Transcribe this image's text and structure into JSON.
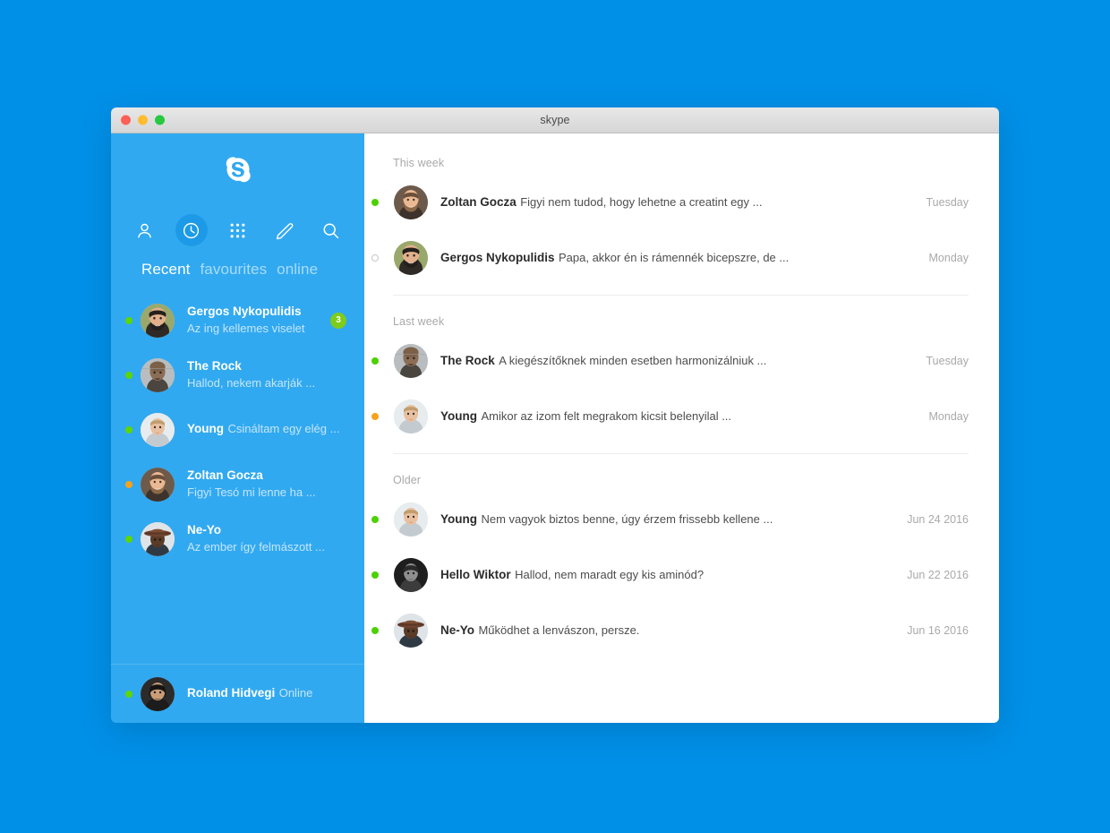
{
  "colors": {
    "page_background": "#0090e8",
    "sidebar_background": "#31a9f0",
    "active_icon_background": "#1d9ae7",
    "badge_green": "#7ecc1b",
    "presence_online": "#5ed600",
    "presence_away": "#f7a21b",
    "main_background": "#ffffff"
  },
  "window": {
    "title": "skype",
    "controls": {
      "close_label": "close",
      "minimize_label": "minimize",
      "maximize_label": "maximize"
    }
  },
  "sidebar": {
    "logo_letter": "S",
    "icons": [
      {
        "name": "contacts-icon",
        "active": false
      },
      {
        "name": "recent-clock-icon",
        "active": true
      },
      {
        "name": "dialpad-icon",
        "active": false
      },
      {
        "name": "compose-pencil-icon",
        "active": false
      },
      {
        "name": "search-icon",
        "active": false
      }
    ],
    "tabs": [
      {
        "label": "Recent",
        "active": true
      },
      {
        "label": "favourites",
        "active": false
      },
      {
        "label": "online",
        "active": false
      }
    ],
    "chats": [
      {
        "name": "Gergos Nykopulidis",
        "snippet": "Az ing kellemes viselet",
        "presence": "online",
        "badge": "3",
        "avatar": "man-beard-green"
      },
      {
        "name": "The Rock",
        "snippet": "Hallod, nekem akarják ...",
        "presence": "online",
        "badge": "",
        "avatar": "man-bald-gray"
      },
      {
        "name": "Young",
        "snippet": "Csináltam egy elég ...",
        "presence": "online",
        "badge": "",
        "avatar": "man-young-light"
      },
      {
        "name": "Zoltan Gocza",
        "snippet": "Figyi Tesó mi lenne ha ...",
        "presence": "away",
        "badge": "",
        "avatar": "man-beard-brown"
      },
      {
        "name": "Ne-Yo",
        "snippet": "Az ember így felmászott ...",
        "presence": "online",
        "badge": "",
        "avatar": "man-hat-dark"
      }
    ],
    "me": {
      "name": "Roland Hidvegi",
      "status": "Online",
      "presence": "online",
      "avatar": "man-dark-hair"
    }
  },
  "main": {
    "sections": [
      {
        "heading": "This week",
        "rows": [
          {
            "name": "Zoltan Gocza",
            "snippet": "Figyi nem tudod, hogy lehetne a creatint egy ...",
            "time": "Tuesday",
            "presence": "online",
            "avatar": "man-beard-brown"
          },
          {
            "name": "Gergos Nykopulidis",
            "snippet": "Papa, akkor én is rámennék bicepszre, de ...",
            "time": "Monday",
            "presence": "offline",
            "avatar": "man-beard-green"
          }
        ]
      },
      {
        "heading": "Last week",
        "rows": [
          {
            "name": "The Rock",
            "snippet": "A kiegészítőknek minden esetben harmonizálniuk ...",
            "time": "Tuesday",
            "presence": "online",
            "avatar": "man-bald-gray"
          },
          {
            "name": "Young",
            "snippet": "Amikor az izom felt megrakom kicsit belenyilal ...",
            "time": "Monday",
            "presence": "away",
            "avatar": "man-young-light"
          }
        ]
      },
      {
        "heading": "Older",
        "rows": [
          {
            "name": "Young",
            "snippet": "Nem vagyok biztos benne, úgy érzem frissebb kellene ...",
            "time": "Jun 24 2016",
            "presence": "online",
            "avatar": "man-young-light"
          },
          {
            "name": "Hello Wiktor",
            "snippet": "Hallod, nem maradt egy kis aminód?",
            "time": "Jun 22 2016",
            "presence": "online",
            "avatar": "man-bw-portrait"
          },
          {
            "name": "Ne-Yo",
            "snippet": "Működhet a lenvászon, persze.",
            "time": "Jun 16 2016",
            "presence": "online",
            "avatar": "man-hat-dark"
          }
        ]
      }
    ]
  }
}
